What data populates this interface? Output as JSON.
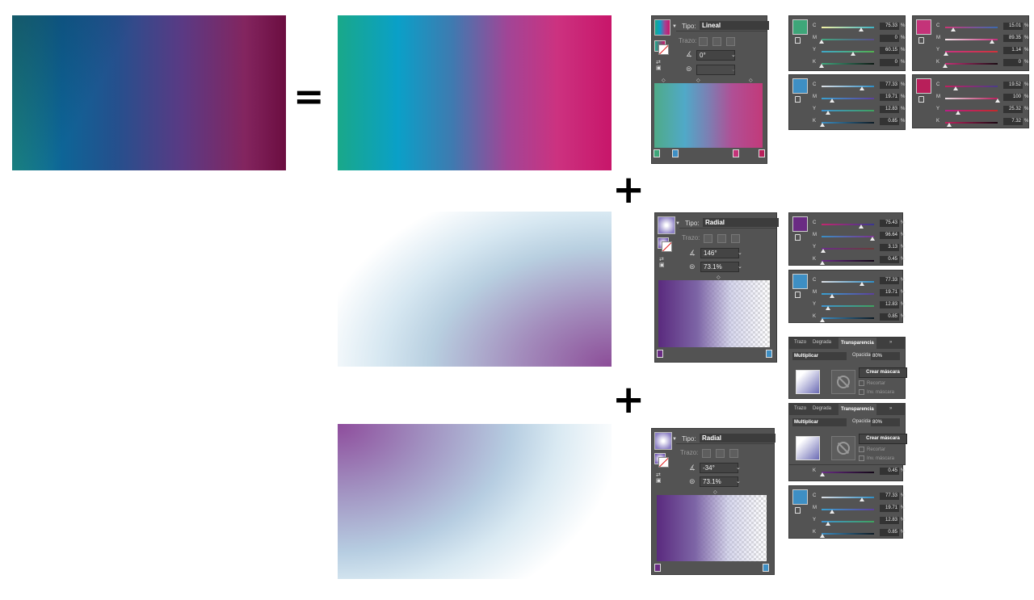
{
  "symbols": {
    "equals": "=",
    "plus": "+"
  },
  "colors": {
    "panel_bg": "#535353",
    "field_bg": "#3c3c3c",
    "text": "#dddddd"
  },
  "icons": {
    "angle": "angle-icon",
    "aspect": "aspect-ratio-icon",
    "delete": "trash-icon",
    "swap": "swap-fill-stroke-icon",
    "no_mask": "no-sign-icon"
  },
  "gradient_panels": [
    {
      "tipo_label": "Tipo:",
      "tipo": "Lineal",
      "trazo_label": "Trazo:",
      "angle": "0°",
      "aspect": ""
    },
    {
      "tipo_label": "Tipo:",
      "tipo": "Radial",
      "trazo_label": "Trazo:",
      "angle": "146°",
      "aspect": "73.1%"
    },
    {
      "tipo_label": "Tipo:",
      "tipo": "Radial",
      "trazo_label": "Trazo:",
      "angle": "-34°",
      "aspect": "73.1%"
    }
  ],
  "color_panels": [
    {
      "swatch": "#3ea679",
      "rows": [
        {
          "ch": "C",
          "value": "75.33",
          "level": 0.75,
          "track": "linear-gradient(90deg,#f4f3a5,#3fb3c5)"
        },
        {
          "ch": "M",
          "value": "0",
          "level": 0,
          "track": "linear-gradient(90deg,#41a87e,#5a4d8b)"
        },
        {
          "ch": "Y",
          "value": "60.15",
          "level": 0.6,
          "track": "linear-gradient(90deg,#40a8c8,#52b050)"
        },
        {
          "ch": "K",
          "value": "0",
          "level": 0,
          "track": "linear-gradient(90deg,#41a97f,#0d1914)"
        }
      ]
    },
    {
      "swatch": "#c43379",
      "rows": [
        {
          "ch": "C",
          "value": "15.01",
          "level": 0.15,
          "track": "linear-gradient(90deg,#ca3877,#3b6ab0)"
        },
        {
          "ch": "M",
          "value": "89.35",
          "level": 0.89,
          "track": "linear-gradient(90deg,#f4e6ea,#c22b77)"
        },
        {
          "ch": "Y",
          "value": "1.14",
          "level": 0.01,
          "track": "linear-gradient(90deg,#c83381,#d0333a)"
        },
        {
          "ch": "K",
          "value": "0",
          "level": 0,
          "track": "linear-gradient(90deg,#c63278,#1a0a12)"
        }
      ]
    },
    {
      "swatch": "#3e8fc4",
      "rows": [
        {
          "ch": "C",
          "value": "77.33",
          "level": 0.77,
          "track": "linear-gradient(90deg,#dcdfe4,#2f8ec6)"
        },
        {
          "ch": "M",
          "value": "19.71",
          "level": 0.2,
          "track": "linear-gradient(90deg,#3aa0d0,#5c3f9c)"
        },
        {
          "ch": "Y",
          "value": "12.83",
          "level": 0.13,
          "track": "linear-gradient(90deg,#3f93d0,#3fa25f)"
        },
        {
          "ch": "K",
          "value": "0.85",
          "level": 0.01,
          "track": "linear-gradient(90deg,#3d8fc4,#0c1a24)"
        }
      ]
    },
    {
      "swatch": "#b81f5a",
      "rows": [
        {
          "ch": "C",
          "value": "19.52",
          "level": 0.2,
          "track": "linear-gradient(90deg,#c12060,#4a3d8a)"
        },
        {
          "ch": "M",
          "value": "100",
          "level": 1.0,
          "track": "linear-gradient(90deg,#eadde2,#b71c5a)"
        },
        {
          "ch": "Y",
          "value": "25.32",
          "level": 0.25,
          "track": "linear-gradient(90deg,#bb1d86,#c52a2a)"
        },
        {
          "ch": "K",
          "value": "7.32",
          "level": 0.07,
          "track": "linear-gradient(90deg,#c22360,#1a0510)"
        }
      ]
    },
    {
      "swatch": "#6a2b83",
      "rows": [
        {
          "ch": "C",
          "value": "75.43",
          "level": 0.75,
          "track": "linear-gradient(90deg,#c2276e,#3a3690)"
        },
        {
          "ch": "M",
          "value": "96.64",
          "level": 0.97,
          "track": "linear-gradient(90deg,#3a8fc4,#7b3290)"
        },
        {
          "ch": "Y",
          "value": "3.13",
          "level": 0.03,
          "track": "linear-gradient(90deg,#6b2c88,#6a3c3a)"
        },
        {
          "ch": "K",
          "value": "0.45",
          "level": 0.01,
          "track": "linear-gradient(90deg,#6a2b85,#120616)"
        }
      ]
    },
    {
      "swatch": "#3e8fc4",
      "rows": [
        {
          "ch": "C",
          "value": "77.33",
          "level": 0.77,
          "track": "linear-gradient(90deg,#dcdfe4,#2f8ec6)"
        },
        {
          "ch": "M",
          "value": "19.71",
          "level": 0.2,
          "track": "linear-gradient(90deg,#3aa0d0,#5c3f9c)"
        },
        {
          "ch": "Y",
          "value": "12.83",
          "level": 0.13,
          "track": "linear-gradient(90deg,#3f93d0,#3fa25f)"
        },
        {
          "ch": "K",
          "value": "0.85",
          "level": 0.01,
          "track": "linear-gradient(90deg,#3d8fc4,#0c1a24)"
        }
      ]
    },
    {
      "swatch": "#3e8fc4",
      "rows": [
        {
          "ch": "C",
          "value": "77.33",
          "level": 0.77,
          "track": "linear-gradient(90deg,#dcdfe4,#2f8ec6)"
        },
        {
          "ch": "M",
          "value": "19.71",
          "level": 0.2,
          "track": "linear-gradient(90deg,#3aa0d0,#5c3f9c)"
        },
        {
          "ch": "Y",
          "value": "12.83",
          "level": 0.13,
          "track": "linear-gradient(90deg,#3f93d0,#3fa25f)"
        },
        {
          "ch": "K",
          "value": "0.85",
          "level": 0.01,
          "track": "linear-gradient(90deg,#3d8fc4,#0c1a24)"
        }
      ]
    }
  ],
  "partial_row": {
    "ch": "K",
    "value": "0.45",
    "level": 0.01,
    "track": "linear-gradient(90deg,#6a2b85,#120616)"
  },
  "transparency": {
    "tab_trazo": "Trazo",
    "tab_degradado": "Degrada",
    "tab_transparencia": "Transparencia",
    "tab_more": "»",
    "blend_mode": "Multiplicar",
    "opacity_label": "Opacidad:",
    "opacity_value": "80%",
    "make_mask": "Crear máscara",
    "clip": "Recortar",
    "invert": "Inv. máscara"
  }
}
